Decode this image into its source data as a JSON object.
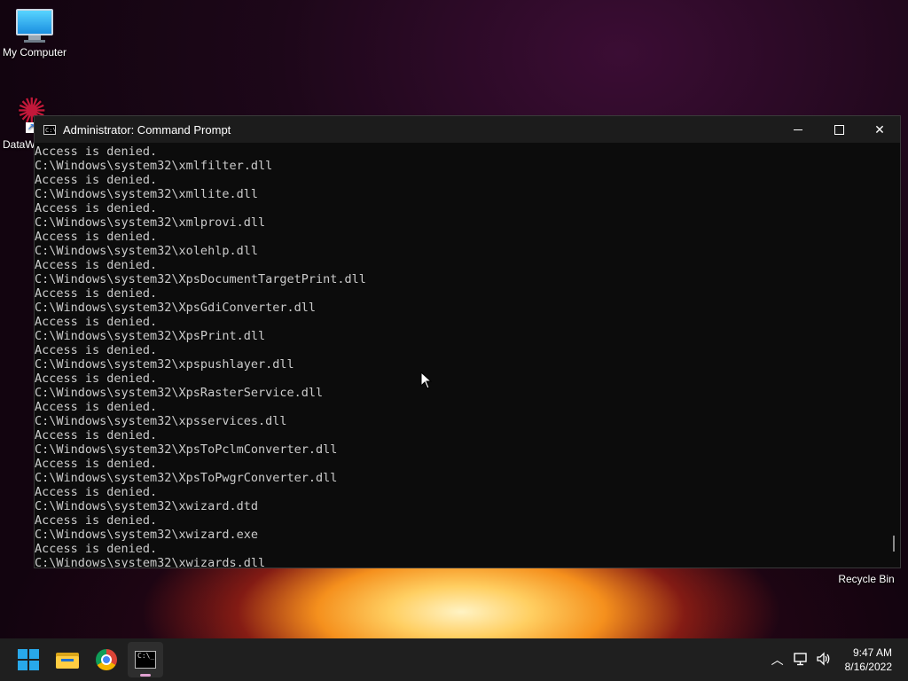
{
  "desktop": {
    "icons": [
      {
        "label": "My Computer",
        "icon": "computer-icon"
      },
      {
        "label": "DataW",
        "icon": "datawrapper-icon"
      },
      {
        "label": "Recycle Bin",
        "icon": "recycle-bin-icon"
      }
    ]
  },
  "window": {
    "title": "Administrator: Command Prompt",
    "icon": "cmd-icon",
    "controls": {
      "minimize": "minimize-icon",
      "maximize": "maximize-icon",
      "close": "close-icon"
    },
    "console_lines": [
      "Access is denied.",
      "C:\\Windows\\system32\\xmlfilter.dll",
      "Access is denied.",
      "C:\\Windows\\system32\\xmllite.dll",
      "Access is denied.",
      "C:\\Windows\\system32\\xmlprovi.dll",
      "Access is denied.",
      "C:\\Windows\\system32\\xolehlp.dll",
      "Access is denied.",
      "C:\\Windows\\system32\\XpsDocumentTargetPrint.dll",
      "Access is denied.",
      "C:\\Windows\\system32\\XpsGdiConverter.dll",
      "Access is denied.",
      "C:\\Windows\\system32\\XpsPrint.dll",
      "Access is denied.",
      "C:\\Windows\\system32\\xpspushlayer.dll",
      "Access is denied.",
      "C:\\Windows\\system32\\XpsRasterService.dll",
      "Access is denied.",
      "C:\\Windows\\system32\\xpsservices.dll",
      "Access is denied.",
      "C:\\Windows\\system32\\XpsToPclmConverter.dll",
      "Access is denied.",
      "C:\\Windows\\system32\\XpsToPwgrConverter.dll",
      "Access is denied.",
      "C:\\Windows\\system32\\xwizard.dtd",
      "Access is denied.",
      "C:\\Windows\\system32\\xwizard.exe",
      "Access is denied.",
      "C:\\Windows\\system32\\xwizards.dll"
    ]
  },
  "taskbar": {
    "apps": [
      {
        "name": "start",
        "icon": "windows-start-icon"
      },
      {
        "name": "file-explorer",
        "icon": "folder-icon"
      },
      {
        "name": "chrome",
        "icon": "chrome-icon"
      },
      {
        "name": "command-prompt",
        "icon": "cmd-icon",
        "active": true
      }
    ],
    "tray": {
      "icons": [
        "chevron-up-icon",
        "network-icon",
        "volume-icon"
      ],
      "time": "9:47 AM",
      "date": "8/16/2022"
    }
  }
}
